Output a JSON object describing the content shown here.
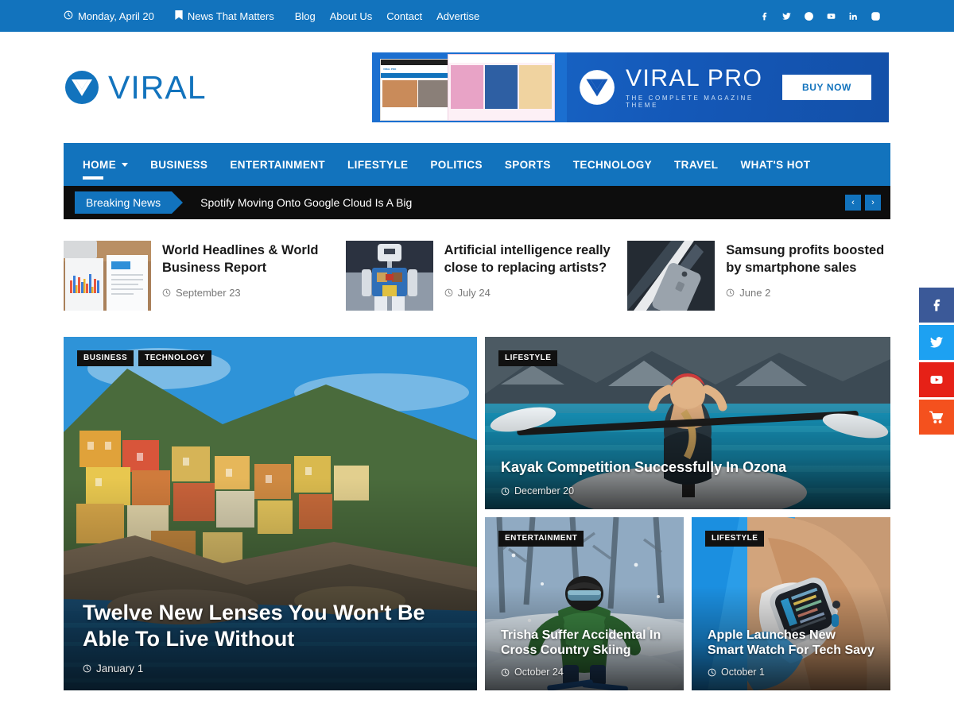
{
  "topbar": {
    "date": "Monday, April 20",
    "date_icon": "clock-icon",
    "tagline": "News That Matters",
    "tagline_icon": "bookmark-icon",
    "links": [
      "Blog",
      "About Us",
      "Contact",
      "Advertise"
    ],
    "social": [
      "facebook-icon",
      "twitter-icon",
      "pinterest-icon",
      "youtube-icon",
      "linkedin-icon",
      "instagram-icon"
    ],
    "bg_color": "#1273bd"
  },
  "header": {
    "logo_text": "VIRAL",
    "logo_color": "#1273bd",
    "ad": {
      "title": "VIRAL PRO",
      "subtitle": "THE COMPLETE MAGAZINE THEME",
      "cta": "BUY NOW",
      "mini_logo_label": "VIRAL PRO"
    }
  },
  "nav": {
    "bg_color": "#1273bd",
    "items": [
      {
        "label": "HOME",
        "active": true,
        "has_dropdown": true
      },
      {
        "label": "BUSINESS",
        "active": false,
        "has_dropdown": false
      },
      {
        "label": "ENTERTAINMENT",
        "active": false,
        "has_dropdown": false
      },
      {
        "label": "LIFESTYLE",
        "active": false,
        "has_dropdown": false
      },
      {
        "label": "POLITICS",
        "active": false,
        "has_dropdown": false
      },
      {
        "label": "SPORTS",
        "active": false,
        "has_dropdown": false
      },
      {
        "label": "TECHNOLOGY",
        "active": false,
        "has_dropdown": false
      },
      {
        "label": "TRAVEL",
        "active": false,
        "has_dropdown": false
      },
      {
        "label": "WHAT'S HOT",
        "active": false,
        "has_dropdown": false
      }
    ]
  },
  "breaking": {
    "label": "Breaking News",
    "headline": "Spotify Moving Onto Google Cloud Is A Big",
    "prev": "‹",
    "next": "›",
    "bg_color": "#0d0d0d",
    "label_color": "#1273bd"
  },
  "features": [
    {
      "title": "World Headlines & World Business Report",
      "date": "September 23",
      "thumb": "desk-charts-photo"
    },
    {
      "title": "Artificial intelligence really close to replacing artists?",
      "date": "July 24",
      "thumb": "robot-photo"
    },
    {
      "title": "Samsung profits boosted by smartphone sales",
      "date": "June 2",
      "thumb": "smartphone-photo"
    }
  ],
  "grid": {
    "main": {
      "badges": [
        "BUSINESS",
        "TECHNOLOGY"
      ],
      "title": "Twelve New Lenses You Won't Be Able To Live Without",
      "date": "January 1",
      "image": "cliffside-village-photo"
    },
    "kayak": {
      "badges": [
        "LIFESTYLE"
      ],
      "title": "Kayak Competition Successfully In Ozona",
      "date": "December 20",
      "image": "kayaker-lake-photo"
    },
    "small": [
      {
        "badges": [
          "ENTERTAINMENT"
        ],
        "title": "Trisha Suffer Accidental In Cross Country Skiing",
        "date": "October 24",
        "image": "skier-snow-photo"
      },
      {
        "badges": [
          "LIFESTYLE"
        ],
        "title": "Apple Launches New Smart Watch For Tech Savy",
        "date": "October 1",
        "image": "smartwatch-wrist-photo"
      }
    ]
  },
  "floating_social": [
    {
      "name": "facebook-icon",
      "color": "#3b5998"
    },
    {
      "name": "twitter-icon",
      "color": "#1da1f2"
    },
    {
      "name": "youtube-icon",
      "color": "#e62117"
    },
    {
      "name": "cart-icon",
      "color": "#f4511e"
    }
  ]
}
